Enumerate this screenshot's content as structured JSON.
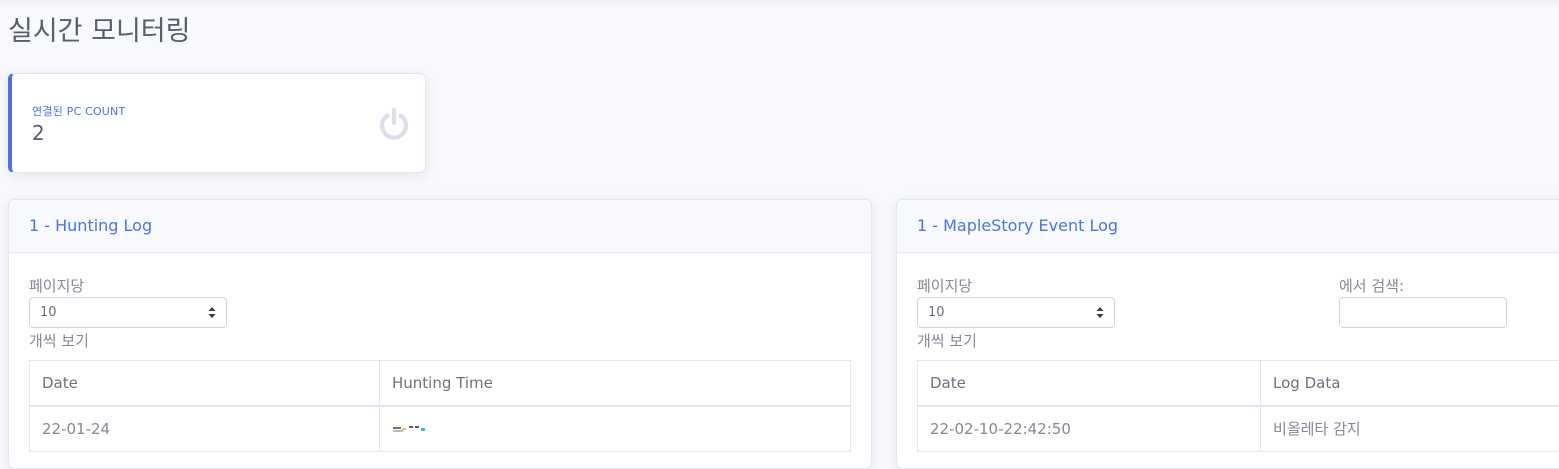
{
  "page": {
    "title": "실시간 모니터링"
  },
  "stat": {
    "label": "연결된 PC COUNT",
    "value": "2",
    "icon": "power-icon"
  },
  "hunting_log": {
    "title": "1 - Hunting Log",
    "length_prefix": "페이지당",
    "length_value": "10",
    "length_suffix": "개씩 보기",
    "columns": [
      "Date",
      "Hunting Time"
    ],
    "rows": [
      {
        "date": "22-01-24",
        "hunting_time": ""
      }
    ]
  },
  "event_log": {
    "title": "1 - MapleStory Event Log",
    "length_prefix": "페이지당",
    "length_value": "10",
    "length_suffix": "개씩 보기",
    "search_label": "에서 검색:",
    "search_value": "",
    "columns": [
      "Date",
      "Log Data"
    ],
    "rows": [
      {
        "date": "22-02-10-22:42:50",
        "log_data": "비올레타 감지"
      }
    ]
  },
  "colors": {
    "accent": "#4e73df",
    "text": "#858796",
    "background": "#f8f9fc"
  }
}
